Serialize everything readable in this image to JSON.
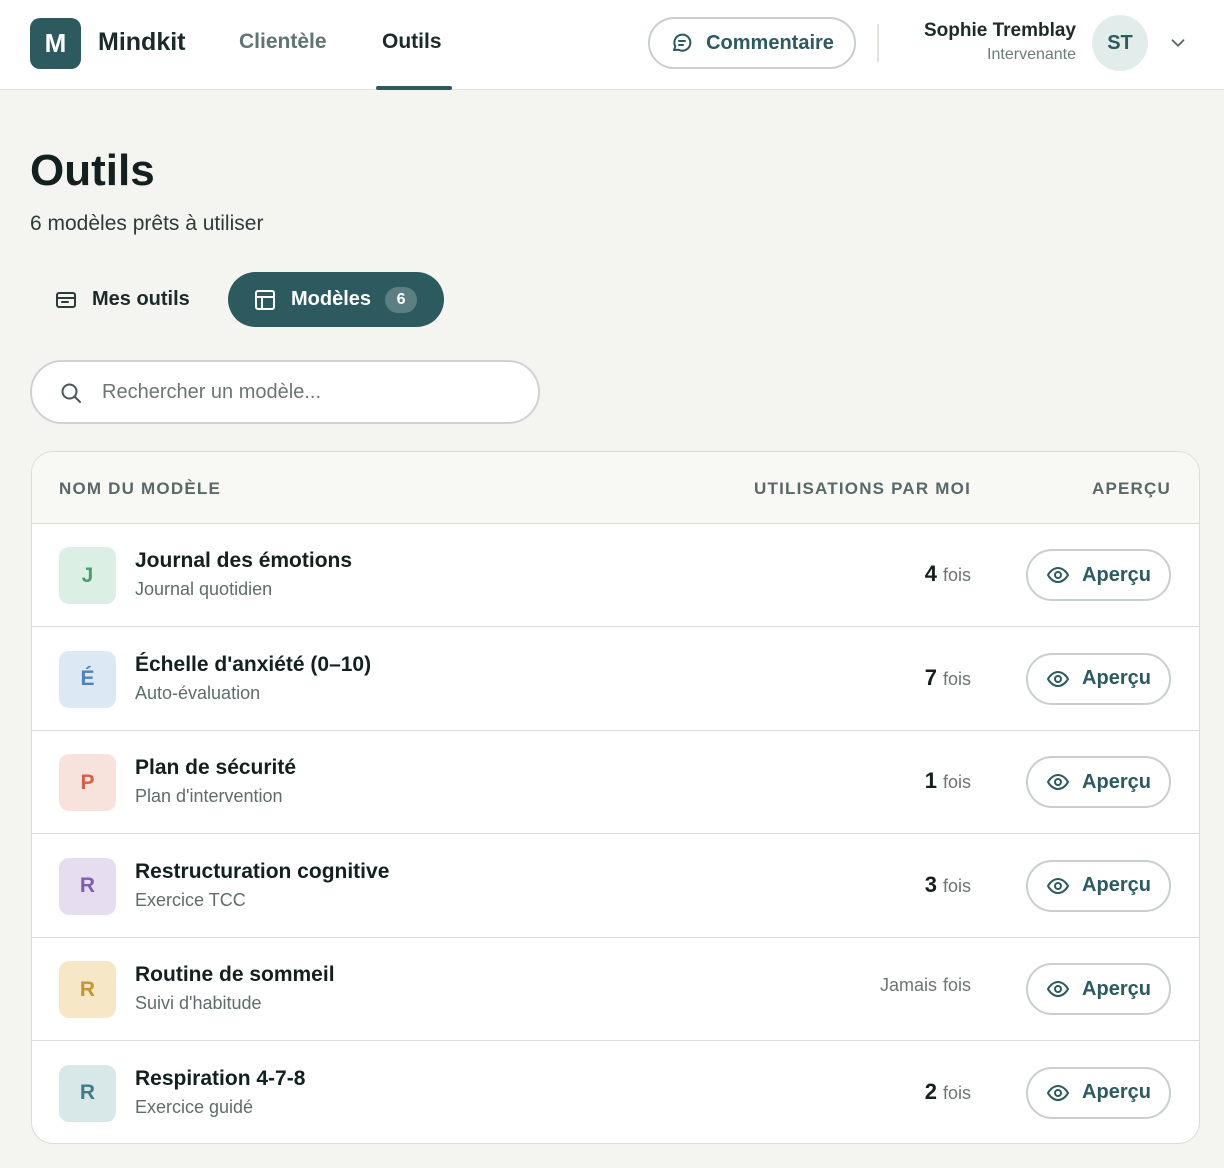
{
  "topbar": {
    "logo_letter": "M",
    "brand": "Mindkit",
    "nav": {
      "clientele": "Clientèle",
      "outils": "Outils"
    },
    "feedback_label": "Commentaire",
    "user": {
      "name": "Sophie Tremblay",
      "role": "Intervenante",
      "initials": "ST"
    }
  },
  "page": {
    "title": "Outils",
    "subtitle": "6 modèles prêts à utiliser"
  },
  "tabs": {
    "mes_outils": "Mes outils",
    "modeles": "Modèles",
    "modeles_count": "6"
  },
  "search": {
    "placeholder": "Rechercher un modèle..."
  },
  "table": {
    "headers": {
      "name": "NOM DU MODÈLE",
      "usage": "UTILISATIONS PAR MOI",
      "preview": "APERÇU"
    },
    "rows": [
      {
        "initial": "J",
        "chip_bg": "#dcefe4",
        "chip_fg": "#4f9a6b",
        "title": "Journal des émotions",
        "subtitle": "Journal quotidien",
        "usage": "4",
        "unit": "fois",
        "preview": "Aperçu"
      },
      {
        "initial": "É",
        "chip_bg": "#dce8f4",
        "chip_fg": "#4c82bd",
        "title": "Échelle d'anxiété (0–10)",
        "subtitle": "Auto-évaluation",
        "usage": "7",
        "unit": "fois",
        "preview": "Aperçu"
      },
      {
        "initial": "P",
        "chip_bg": "#f8e2dc",
        "chip_fg": "#d2614a",
        "title": "Plan de sécurité",
        "subtitle": "Plan d'intervention",
        "usage": "1",
        "unit": "fois",
        "preview": "Aperçu"
      },
      {
        "initial": "R",
        "chip_bg": "#e6def0",
        "chip_fg": "#7f5eae",
        "title": "Restructuration cognitive",
        "subtitle": "Exercice TCC",
        "usage": "3",
        "unit": "fois",
        "preview": "Aperçu"
      },
      {
        "initial": "R",
        "chip_bg": "#f6e8c6",
        "chip_fg": "#c49333",
        "title": "Routine de sommeil",
        "subtitle": "Suivi d'habitude",
        "usage": "Jamais",
        "unit": "fois",
        "preview": "Aperçu"
      },
      {
        "initial": "R",
        "chip_bg": "#d8e7e8",
        "chip_fg": "#3f7d84",
        "title": "Respiration 4-7-8",
        "subtitle": "Exercice guidé",
        "usage": "2",
        "unit": "fois",
        "preview": "Aperçu"
      }
    ]
  },
  "colors": {
    "accent": "#2c5a5f",
    "background": "#f4f4f0"
  },
  "icons": {
    "feedback": "chat-bubble-icon",
    "chevron": "chevron-down-icon",
    "mes_outils": "card-icon",
    "modeles": "layout-template-icon",
    "search": "search-icon",
    "preview": "eye-icon"
  }
}
